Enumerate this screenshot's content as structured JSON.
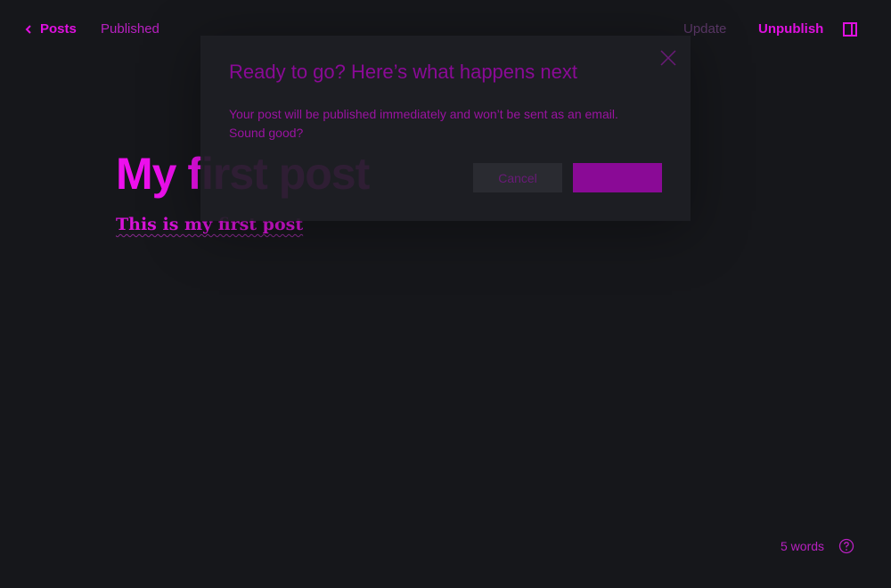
{
  "header": {
    "back_label": "Posts",
    "status": "Published",
    "update_label": "Update",
    "unpublish_label": "Unpublish"
  },
  "post": {
    "title": "My first post",
    "body": "This is my first post"
  },
  "footer": {
    "word_count": "5 words"
  },
  "modal": {
    "title": "Ready to go? Here’s what happens next",
    "body": "Your post will be published immediately and won’t be sent as an email. Sound good?",
    "cancel_label": "Cancel",
    "confirm_label": ""
  },
  "icons": {
    "back": "chevron-left-icon",
    "settings": "sidebar-panel-icon",
    "help": "question-circle-icon",
    "close": "close-icon"
  },
  "colors": {
    "background": "#16171b",
    "accent": "#e010e0",
    "modal_bg": "#1e1f24",
    "primary_button": "#8a0a96"
  }
}
